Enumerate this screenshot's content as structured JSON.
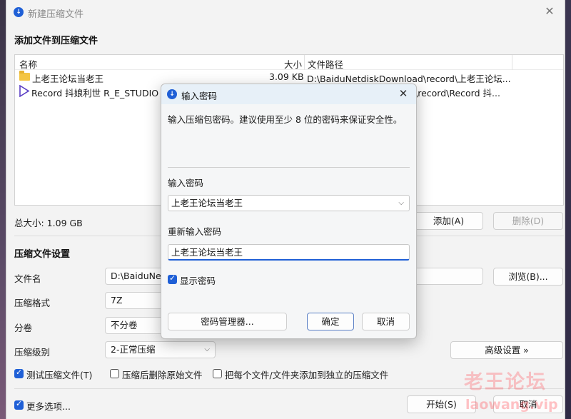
{
  "window": {
    "title": "新建压缩文件",
    "close_glyph": "✕"
  },
  "add_section": {
    "title": "添加文件到压缩文件",
    "columns": {
      "name": "名称",
      "size": "大小",
      "path": "文件路径"
    },
    "rows": [
      {
        "icon": "folder-icon",
        "name": "上老王论坛当老王",
        "size": "3.09 KB",
        "path": "D:\\BaiduNetdiskDownload\\record\\上老王论坛..."
      },
      {
        "icon": "video-icon",
        "name": "Record  抖娘利世  R_E_STUDIO",
        "size": "",
        "path": "\\record\\Record  抖..."
      }
    ],
    "total_size": "总大小: 1.09 GB",
    "add_button": "添加(A)",
    "delete_button": "删除(D)"
  },
  "settings": {
    "title": "压缩文件设置",
    "filename_label": "文件名",
    "filename_value": "D:\\BaiduNet",
    "browse_button": "浏览(B)...",
    "format_label": "压缩格式",
    "format_value": "7Z",
    "split_label": "分卷",
    "split_value": "不分卷",
    "level_label": "压缩级别",
    "level_value": "2-正常压缩",
    "advanced_button": "高级设置 »",
    "test_checkbox": {
      "label": "测试压缩文件(T)",
      "checked": true
    },
    "delete_after_checkbox": {
      "label": "压缩后删除原始文件",
      "checked": false
    },
    "separate_checkbox": {
      "label": "把每个文件/文件夹添加到独立的压缩文件",
      "checked": false
    }
  },
  "footer": {
    "more_options": {
      "label": "更多选项...",
      "checked": true
    },
    "start_button": "开始(S)",
    "cancel_button": "取消"
  },
  "watermark": {
    "text": "老王论坛",
    "url": "laowang.vip"
  },
  "dialog": {
    "title": "输入密码",
    "close_glyph": "✕",
    "description": "输入压缩包密码。建议使用至少 8 位的密码来保证安全性。",
    "password_label": "输入密码",
    "password_value": "上老王论坛当老王",
    "confirm_label": "重新输入密码",
    "confirm_value": "上老王论坛当老王",
    "show_password": {
      "label": "显示密码",
      "checked": true
    },
    "manager_button": "密码管理器...",
    "ok_button": "确定",
    "cancel_button": "取消"
  },
  "colors": {
    "accent": "#1f5fd6",
    "window_bg": "#f3f3f3",
    "dialog_title_bg": "#e7f0f8"
  }
}
